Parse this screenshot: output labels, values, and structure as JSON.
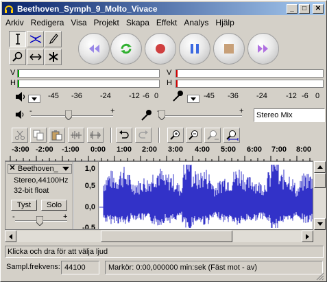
{
  "window": {
    "title": "Beethoven_Symph_9_Molto_Vivace",
    "minimize_glyph": "_",
    "maximize_glyph": "□",
    "close_glyph": "✕"
  },
  "menu": {
    "items": [
      "Arkiv",
      "Redigera",
      "Visa",
      "Projekt",
      "Skapa",
      "Effekt",
      "Analys",
      "Hjälp"
    ]
  },
  "tools": [
    "selection-tool",
    "envelope-tool",
    "draw-tool",
    "zoom-tool",
    "timeshift-tool",
    "multi-tool"
  ],
  "transport": [
    "skip-to-start",
    "play",
    "record",
    "pause",
    "stop",
    "skip-to-end"
  ],
  "meters": {
    "left_label": "V",
    "right_label": "H",
    "scale": [
      "-45",
      "-36",
      "-24",
      "-12",
      "-6",
      "0"
    ],
    "colors": {
      "playback_marker": "#00a000",
      "record_marker": "#d00000"
    }
  },
  "mixer": {
    "minus": "-",
    "plus": "+",
    "input_source": "Stereo Mix"
  },
  "ruler": {
    "ticks": [
      "-3:00",
      "-2:00",
      "-1:00",
      "0:00",
      "1:00",
      "2:00",
      "3:00",
      "4:00",
      "5:00",
      "6:00",
      "7:00",
      "8:00"
    ]
  },
  "track": {
    "name": "Beethoven_",
    "close_glyph": "✕",
    "format_line1": "Stereo,44100Hz",
    "format_line2": "32-bit float",
    "mute_label": "Tyst",
    "solo_label": "Solo",
    "scale": [
      "1,0",
      "0,5",
      "0,0",
      "-0,5"
    ],
    "wave_color": "#3232c8"
  },
  "status": {
    "hint": "Klicka och dra för att välja ljud",
    "rate_label": "Sampl.frekvens:",
    "rate_value": "44100",
    "cursor_text": "Markör: 0:00,000000 min:sek  (Fäst mot - av)"
  }
}
